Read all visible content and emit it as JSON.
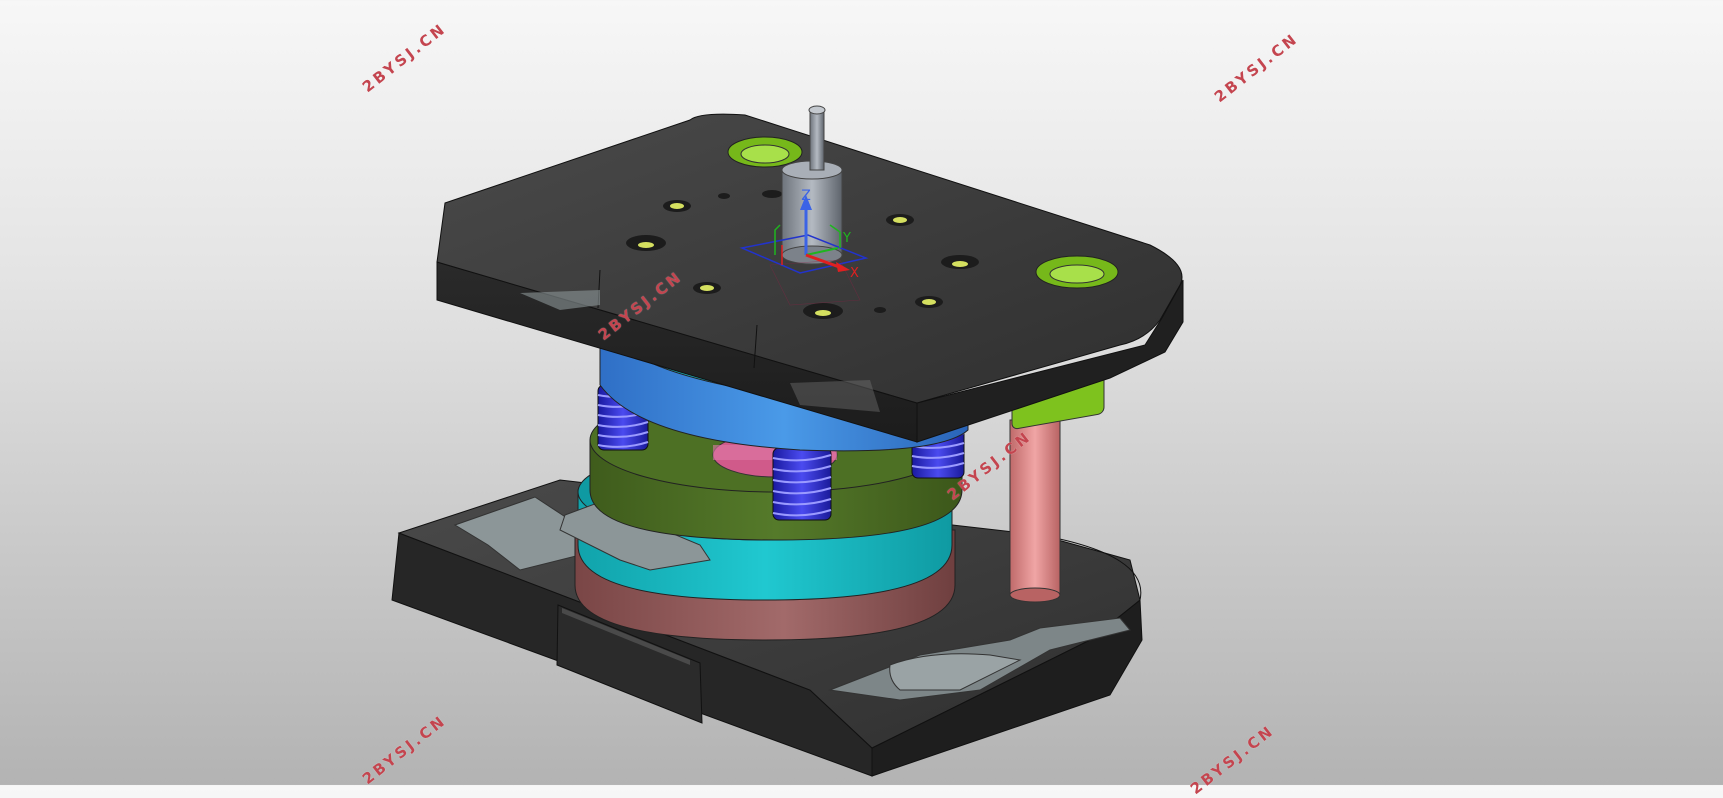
{
  "viewport": {
    "background_top": "#f7f7f7",
    "background_bottom": "#b3b3b3"
  },
  "watermarks": [
    "2BYSJ.CN",
    "2BYSJ.CN",
    "2BYSJ.CN",
    "2BYSJ.CN",
    "2BYSJ.CN",
    "2BYSJ.CN",
    "2BYSJ.CN"
  ],
  "triad": {
    "z_label": "Z",
    "y_label": "Y",
    "x_label": "X",
    "z_color": "#3b63e6",
    "y_color": "#1fb51f",
    "x_color": "#e02020"
  },
  "parts": {
    "plates_color": "#3c3c3c",
    "stripper_color": "#3a86d8",
    "punch_plate_color": "#4a6a22",
    "die_ring_color": "#18b8c0",
    "base_ring_color": "#8a5252",
    "springs_color": "#2a2ad0",
    "guide_post_color": "#e39090",
    "guide_bush_color": "#7ec21e",
    "shank_color": "#8a9098",
    "strip_color": "#8c9698"
  }
}
